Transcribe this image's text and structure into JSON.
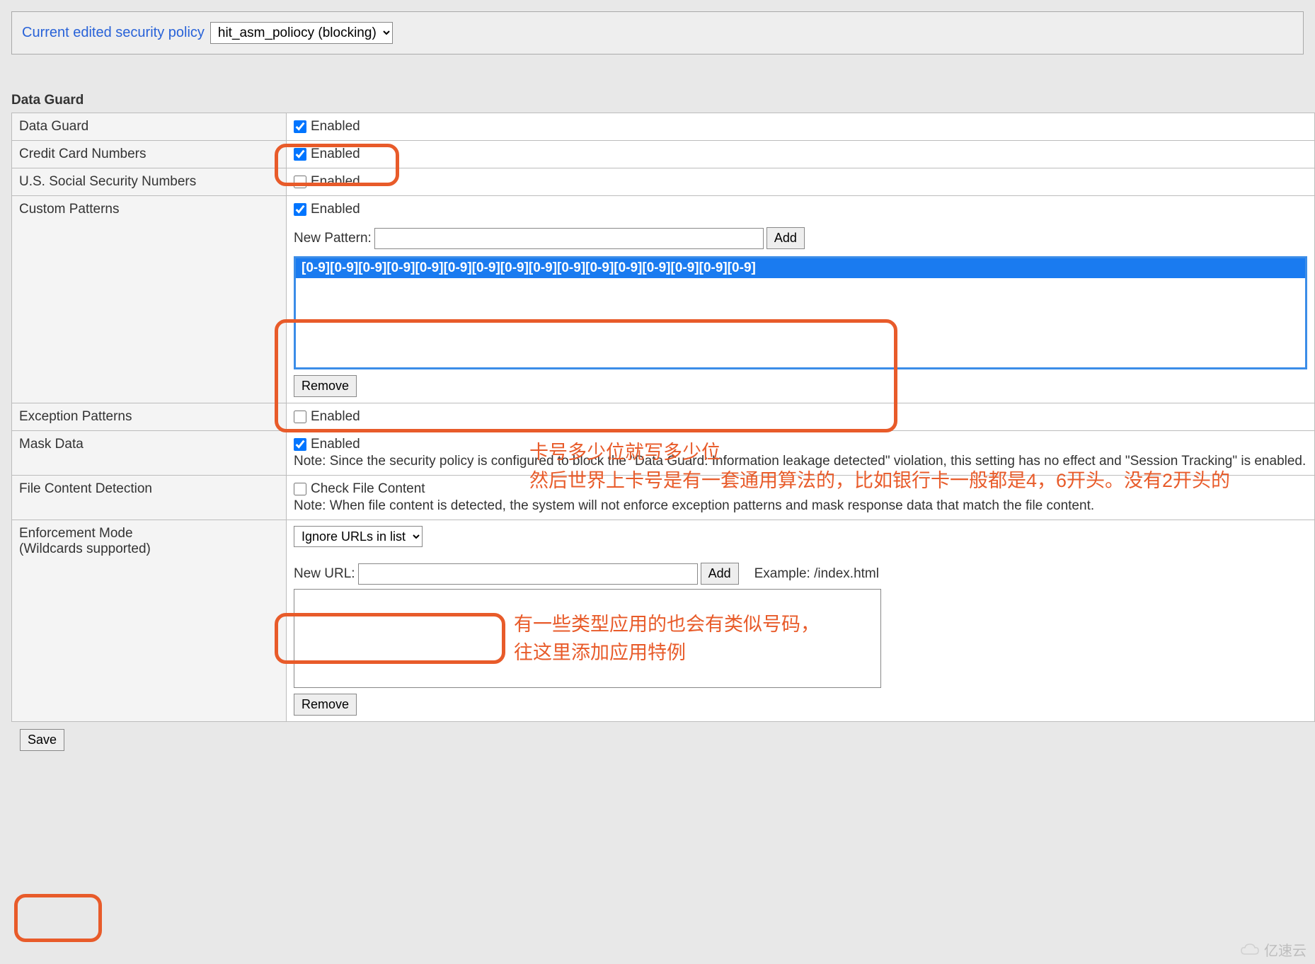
{
  "policyBar": {
    "label": "Current edited security policy",
    "selected": "hit_asm_poliocy (blocking)"
  },
  "sectionTitle": "Data Guard",
  "rows": {
    "dataGuard": {
      "label": "Data Guard",
      "enabledLabel": "Enabled"
    },
    "ccn": {
      "label": "Credit Card Numbers",
      "enabledLabel": "Enabled"
    },
    "ssn": {
      "label": "U.S. Social Security Numbers",
      "enabledLabel": "Enabled"
    },
    "custom": {
      "label": "Custom Patterns",
      "enabledLabel": "Enabled",
      "newPatternLabel": "New Pattern:",
      "addLabel": "Add",
      "removeLabel": "Remove",
      "pattern": "[0-9][0-9][0-9][0-9][0-9][0-9][0-9][0-9][0-9][0-9][0-9][0-9][0-9][0-9][0-9][0-9]"
    },
    "exception": {
      "label": "Exception Patterns",
      "enabledLabel": "Enabled"
    },
    "mask": {
      "label": "Mask Data",
      "enabledLabel": "Enabled",
      "note": "Note: Since the security policy is configured to block the \"Data Guard: Information leakage detected\" violation, this setting has no effect and \"Session Tracking\" is enabled."
    },
    "file": {
      "label": "File Content Detection",
      "checkLabel": "Check File Content",
      "note": "Note: When file content is detected, the system will not enforce exception patterns and mask response data that match the file content."
    },
    "enforce": {
      "label1": "Enforcement Mode",
      "label2": "(Wildcards supported)",
      "selectLabel": "Ignore URLs in list",
      "newUrlLabel": "New URL:",
      "addLabel": "Add",
      "example": "Example: /index.html",
      "removeLabel": "Remove"
    }
  },
  "saveLabel": "Save",
  "annotations": {
    "custom1": "卡号多少位就写多少位",
    "custom2": "然后世界上卡号是有一套通用算法的，比如银行卡一般都是4，6开头。没有2开头的",
    "file1": "有一些类型应用的也会有类似号码，",
    "file2": "往这里添加应用特例"
  },
  "watermark": "亿速云"
}
